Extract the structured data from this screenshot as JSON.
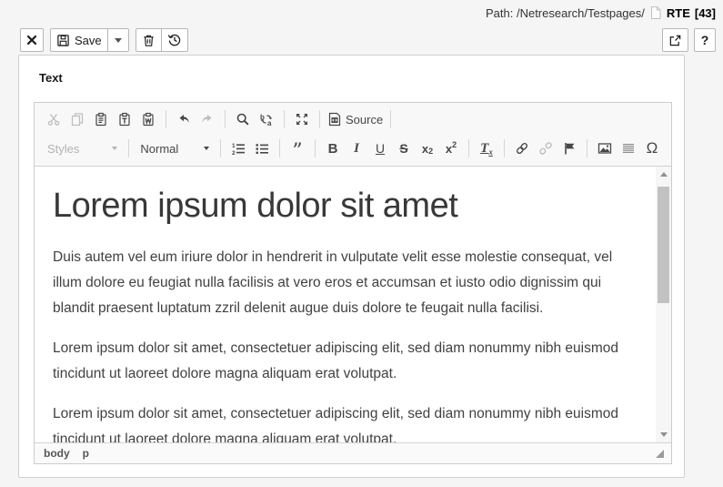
{
  "colors": {
    "page_bg": "#f5f5f5",
    "panel_border": "#cfcfcf",
    "toolbar_bg": "#f8f8f8",
    "chrome_border": "#d1d1d1",
    "icon_enabled": "#474747",
    "icon_disabled": "#bdbdbd",
    "body_text": "#414141",
    "heading_text": "#383838"
  },
  "header": {
    "path": "Path: /Netresearch/Testpages/",
    "record_title": "RTE",
    "record_uid": "[43]"
  },
  "docheader": {
    "save_label": "Save",
    "help_label": "?"
  },
  "form": {
    "field_label": "Text"
  },
  "editor": {
    "combos": {
      "styles": "Styles",
      "format": "Normal"
    },
    "source_label": "Source",
    "glyphs": {
      "bold": "B",
      "italic": "I",
      "underline": "U",
      "strike": "S",
      "sub_base": "x",
      "sub_mark": "2",
      "sup_base": "x",
      "sup_mark": "2",
      "removeformat_base": "T",
      "removeformat_mark": "x",
      "blockquote": "”",
      "specialchar": "Ω",
      "numlist_1": "1",
      "numlist_2": "2"
    },
    "icons": [
      "close-icon",
      "save-floppy-icon",
      "dropdown-caret-icon",
      "trash-icon",
      "history-icon",
      "open-new-window-icon",
      "help-icon",
      "document-icon",
      "cut-icon",
      "copy-icon",
      "paste-icon",
      "paste-text-icon",
      "paste-word-icon",
      "undo-icon",
      "redo-icon",
      "find-icon",
      "replace-icon",
      "maximize-icon",
      "source-icon",
      "numbered-list-icon",
      "bulleted-list-icon",
      "blockquote-icon",
      "link-icon",
      "unlink-icon",
      "anchor-flag-icon",
      "image-icon",
      "horizontal-line-icon",
      "special-character-icon",
      "scroll-up-icon",
      "scroll-down-icon",
      "resize-handle-icon"
    ],
    "content": {
      "heading": "Lorem ipsum dolor sit amet",
      "paragraphs": [
        "Duis autem vel eum iriure dolor in hendrerit in vulputate velit esse molestie consequat, vel illum dolore eu feugiat nulla facilisis at vero eros et accumsan et iusto odio dignissim qui blandit praesent luptatum zzril delenit augue duis dolore te feugait nulla facilisi.",
        "Lorem ipsum dolor sit amet, consectetuer adipiscing elit, sed diam nonummy nibh euismod tincidunt ut laoreet dolore magna aliquam erat volutpat.",
        "Lorem ipsum dolor sit amet, consectetuer adipiscing elit, sed diam nonummy nibh euismod tincidunt ut laoreet dolore magna aliquam erat volutpat."
      ]
    },
    "statusbar": {
      "elements": [
        "body",
        "p"
      ]
    }
  }
}
